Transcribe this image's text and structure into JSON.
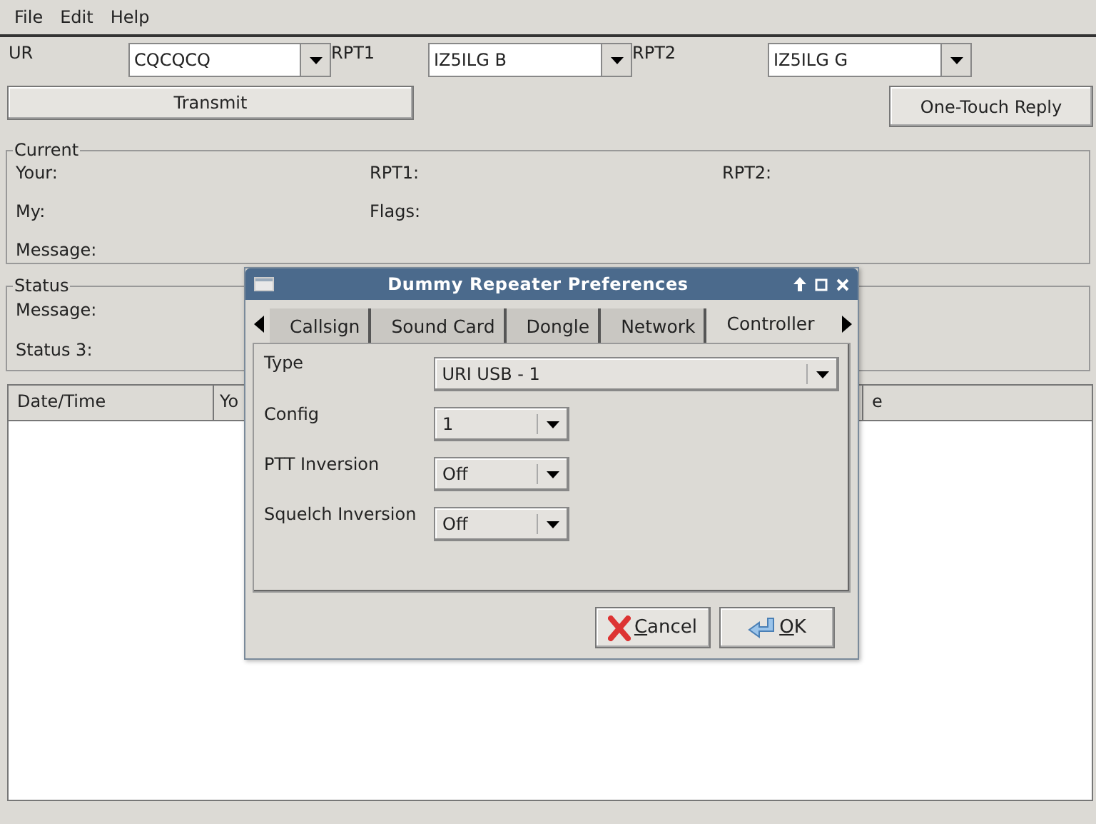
{
  "menu": [
    "File",
    "Edit",
    "Help"
  ],
  "callsign_row": [
    {
      "label": "UR",
      "value": "CQCQCQ"
    },
    {
      "label": "RPT1",
      "value": "IZ5ILG B"
    },
    {
      "label": "RPT2",
      "value": "IZ5ILG G"
    }
  ],
  "transmit_button": "Transmit",
  "reply_button": "One-Touch Reply",
  "current": {
    "title": "Current",
    "fields": [
      "Your:",
      "RPT1:",
      "RPT2:",
      "My:",
      "Flags:",
      "Message:"
    ]
  },
  "status": {
    "title": "Status",
    "fields": [
      "Message:",
      "Status 3:"
    ]
  },
  "table": {
    "columns": [
      "Date/Time",
      "Yo",
      "e"
    ]
  },
  "dialog": {
    "title": "Dummy Repeater Preferences",
    "tabs": [
      {
        "label": "Callsign",
        "selected": false
      },
      {
        "label": "Sound Card",
        "selected": false
      },
      {
        "label": "Dongle",
        "selected": false
      },
      {
        "label": "Network",
        "selected": false
      },
      {
        "label": "Controller",
        "selected": true
      }
    ],
    "rows": [
      {
        "label": "Type",
        "value": "URI USB - 1",
        "kind": "wide"
      },
      {
        "label": "Config",
        "value": "1",
        "kind": "narrow"
      },
      {
        "label": "PTT Inversion",
        "value": "Off",
        "kind": "narrow"
      },
      {
        "label": "Squelch Inversion",
        "value": "Off",
        "kind": "narrow"
      }
    ],
    "buttons": [
      {
        "kind": "cancel",
        "label": "Cancel"
      },
      {
        "kind": "ok",
        "label": "OK"
      }
    ]
  }
}
